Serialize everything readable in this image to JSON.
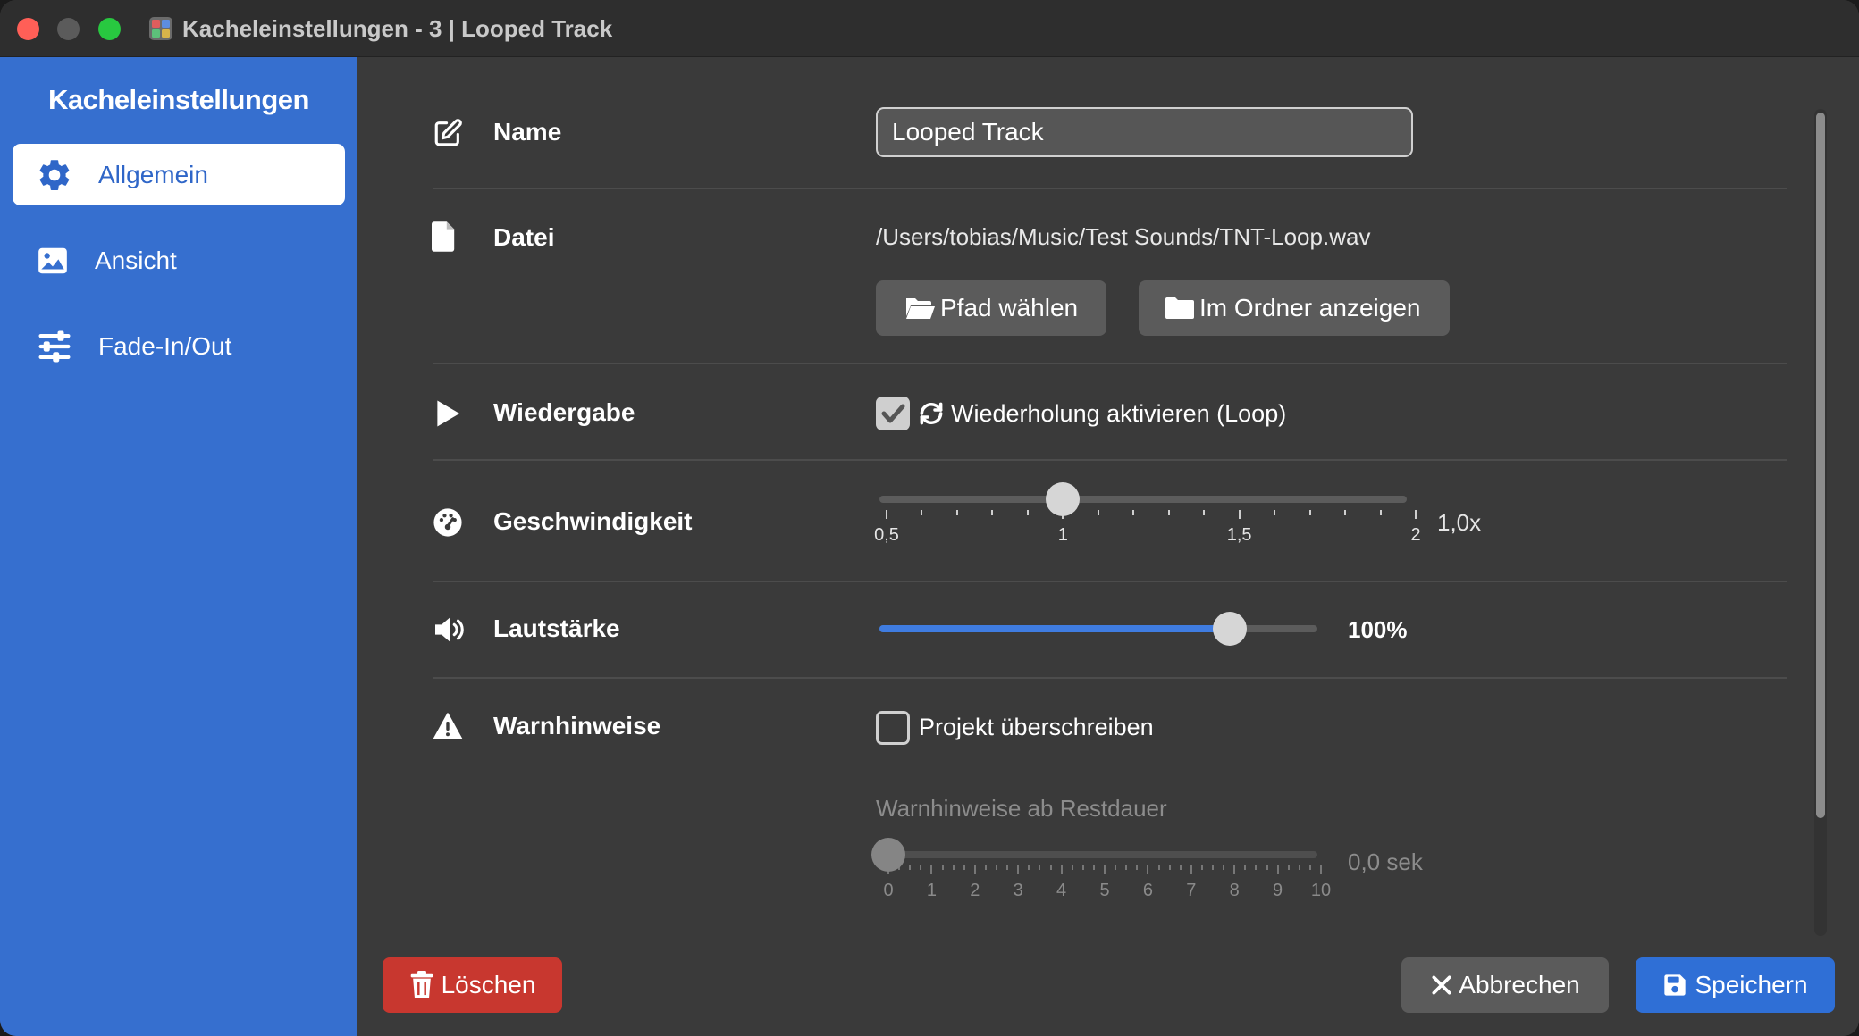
{
  "window": {
    "title": "Kacheleinstellungen - 3 | Looped Track"
  },
  "sidebar": {
    "heading": "Kacheleinstellungen",
    "items": [
      {
        "label": "Allgemein",
        "icon": "gear-icon",
        "active": true
      },
      {
        "label": "Ansicht",
        "icon": "image-icon",
        "active": false
      },
      {
        "label": "Fade-In/Out",
        "icon": "sliders-icon",
        "active": false
      }
    ]
  },
  "rows": {
    "name": {
      "label": "Name",
      "value": "Looped Track"
    },
    "file": {
      "label": "Datei",
      "path": "/Users/tobias/Music/Test Sounds/TNT-Loop.wav",
      "choose_button": "Pfad wählen",
      "show_button": "Im Ordner anzeigen"
    },
    "playback": {
      "label": "Wiedergabe",
      "loop_label": "Wiederholung aktivieren (Loop)",
      "loop_checked": true
    },
    "speed": {
      "label": "Geschwindigkeit",
      "value": 1.0,
      "value_text": "1,0x",
      "min": 0.5,
      "max": 2,
      "tick_labels": [
        "0,5",
        "1",
        "1,5",
        "2"
      ]
    },
    "volume": {
      "label": "Lautstärke",
      "value": 100,
      "value_text": "100%",
      "fill_fraction": 0.8
    },
    "warnings": {
      "label": "Warnhinweise",
      "overwrite_label": "Projekt überschreiben",
      "overwrite_checked": false,
      "remaining_label": "Warnhinweise ab Restdauer",
      "remaining_value": 0,
      "remaining_text": "0,0 sek",
      "tick_labels": [
        "0",
        "1",
        "2",
        "3",
        "4",
        "5",
        "6",
        "7",
        "8",
        "9",
        "10"
      ]
    }
  },
  "footer": {
    "delete_label": "Löschen",
    "cancel_label": "Abbrechen",
    "save_label": "Speichern"
  },
  "colors": {
    "sidebar": "#366fcf",
    "accent": "#3f7ce0",
    "delete": "#c8372f",
    "save": "#2f6fd6"
  }
}
